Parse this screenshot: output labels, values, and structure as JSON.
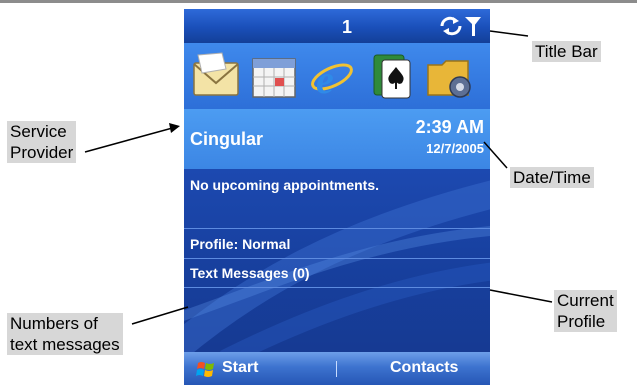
{
  "callouts": {
    "title_bar": "Title Bar",
    "service_provider": "Service \nProvider",
    "date_time": "Date/Time",
    "current_profile": "Current\nProfile",
    "text_messages": "Numbers of \ntext messages"
  },
  "status_bar": {
    "notification_count": "1",
    "icons": [
      "sync-icon",
      "signal-icon"
    ]
  },
  "app_icons": [
    "mail-envelope-icon",
    "calendar-icon",
    "internet-explorer-icon",
    "solitaire-icon",
    "folder-settings-icon"
  ],
  "home": {
    "provider": "Cingular",
    "time": "2:39 AM",
    "date": "12/7/2005",
    "appointments": "No upcoming appointments.",
    "profile": "Profile: Normal",
    "text_messages": "Text Messages (0)"
  },
  "softkeys": {
    "left": "Start",
    "right": "Contacts"
  }
}
